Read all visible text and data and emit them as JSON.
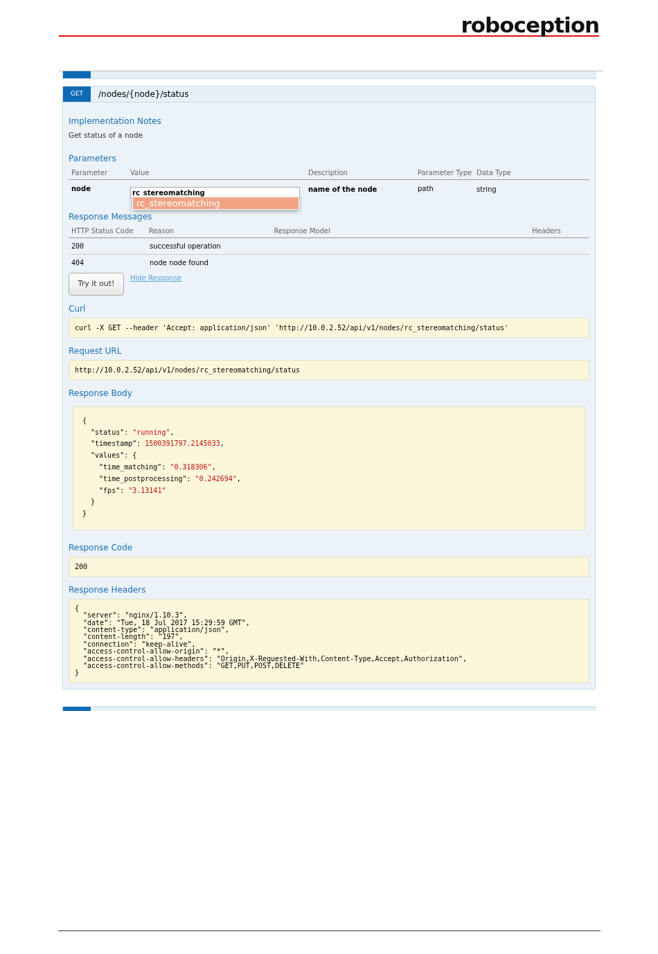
{
  "logo": "roboception",
  "operation": {
    "method": "GET",
    "path": "/nodes/{node}/status"
  },
  "implementation_notes": {
    "title": "Implementation Notes",
    "text": "Get status of a node"
  },
  "parameters": {
    "title": "Parameters",
    "columns": [
      "Parameter",
      "Value",
      "Description",
      "Parameter Type",
      "Data Type"
    ],
    "rows": [
      {
        "name": "node",
        "value": "rc_stereomatching",
        "suggestion": "rc_stereomatching",
        "description": "name of the node",
        "parameter_type": "path",
        "data_type": "string"
      }
    ]
  },
  "response_messages": {
    "title": "Response Messages",
    "columns": [
      "HTTP Status Code",
      "Reason",
      "Response Model",
      "Headers"
    ],
    "rows": [
      {
        "code": "200",
        "reason": "successful operation"
      },
      {
        "code": "404",
        "reason": "node node found"
      }
    ]
  },
  "try_button": "Try it out!",
  "hide_link": "Hide Response",
  "curl": {
    "title": "Curl",
    "text": "curl -X GET --header 'Accept: application/json' 'http://10.0.2.52/api/v1/nodes/rc_stereomatching/status'"
  },
  "request_url": {
    "title": "Request URL",
    "text": "http://10.0.2.52/api/v1/nodes/rc_stereomatching/status"
  },
  "response_body": {
    "title": "Response Body",
    "lines": [
      [
        {
          "kind": "plain",
          "text": "{"
        }
      ],
      [
        {
          "kind": "plain",
          "text": "  \"status\": "
        },
        {
          "kind": "value",
          "text": "\"running\""
        },
        {
          "kind": "plain",
          "text": ","
        }
      ],
      [
        {
          "kind": "plain",
          "text": "  \"timestamp\": "
        },
        {
          "kind": "value",
          "text": "1500391797.2145033"
        },
        {
          "kind": "plain",
          "text": ","
        }
      ],
      [
        {
          "kind": "plain",
          "text": "  \"values\": {"
        }
      ],
      [
        {
          "kind": "plain",
          "text": "    \"time_matching\": "
        },
        {
          "kind": "value",
          "text": "\"0.318306\""
        },
        {
          "kind": "plain",
          "text": ","
        }
      ],
      [
        {
          "kind": "plain",
          "text": "    \"time_postprocessing\": "
        },
        {
          "kind": "value",
          "text": "\"0.242694\""
        },
        {
          "kind": "plain",
          "text": ","
        }
      ],
      [
        {
          "kind": "plain",
          "text": "    \"fps\": "
        },
        {
          "kind": "value",
          "text": "\"3.13141\""
        }
      ],
      [
        {
          "kind": "plain",
          "text": "  }"
        }
      ],
      [
        {
          "kind": "plain",
          "text": "}"
        }
      ]
    ]
  },
  "response_code": {
    "title": "Response Code",
    "text": "200"
  },
  "response_headers": {
    "title": "Response Headers",
    "text": "{\n  \"server\": \"nginx/1.10.3\",\n  \"date\": \"Tue, 18 Jul 2017 15:29:59 GMT\",\n  \"content-type\": \"application/json\",\n  \"content-length\": \"197\",\n  \"connection\": \"keep-alive\",\n  \"access-control-allow-origin\": \"*\",\n  \"access-control-allow-headers\": \"Origin,X-Requested-With,Content-Type,Accept,Authorization\",\n  \"access-control-allow-methods\": \"GET,PUT,POST,DELETE\"\n}"
  }
}
